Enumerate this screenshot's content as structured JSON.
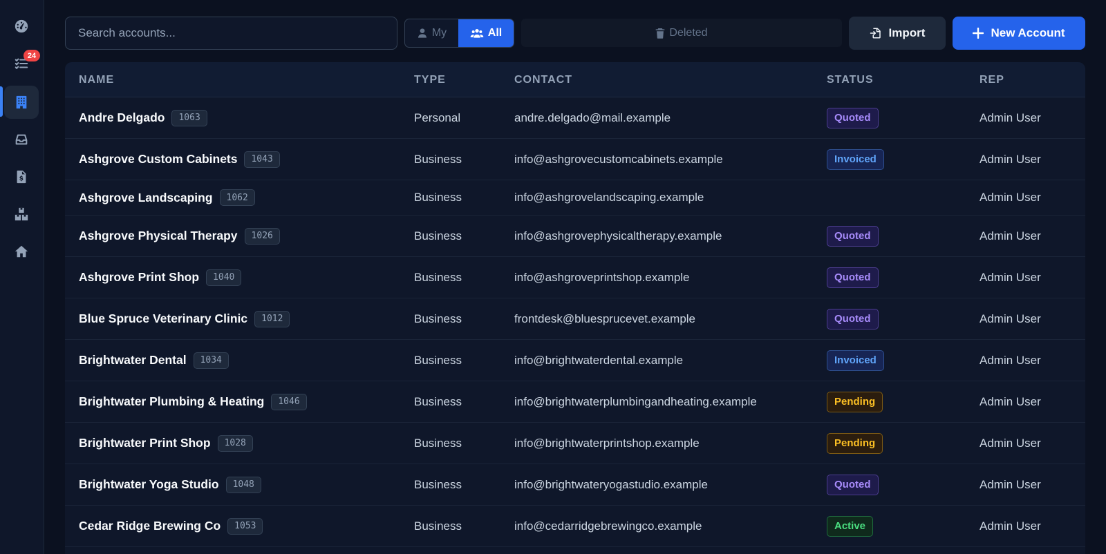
{
  "sidebar": {
    "items": [
      {
        "icon": "dashboard-icon"
      },
      {
        "icon": "tasks-icon",
        "badge": "24"
      },
      {
        "icon": "building-icon",
        "active": true
      },
      {
        "icon": "inbox-icon"
      },
      {
        "icon": "invoice-icon"
      },
      {
        "icon": "boxes-icon"
      },
      {
        "icon": "home-icon"
      }
    ]
  },
  "toolbar": {
    "search_placeholder": "Search accounts...",
    "filter_my": "My",
    "filter_all": "All",
    "deleted_label": "Deleted",
    "import_label": "Import",
    "new_account_label": "New Account"
  },
  "table": {
    "columns": {
      "name": "NAME",
      "type": "TYPE",
      "contact": "CONTACT",
      "status": "STATUS",
      "rep": "REP"
    },
    "rows": [
      {
        "name": "Andre Delgado",
        "id": "1063",
        "type": "Personal",
        "contact": "andre.delgado@mail.example",
        "status": "Quoted",
        "rep": "Admin User"
      },
      {
        "name": "Ashgrove Custom Cabinets",
        "id": "1043",
        "type": "Business",
        "contact": "info@ashgrovecustomcabinets.example",
        "status": "Invoiced",
        "rep": "Admin User"
      },
      {
        "name": "Ashgrove Landscaping",
        "id": "1062",
        "type": "Business",
        "contact": "info@ashgrovelandscaping.example",
        "status": "",
        "rep": "Admin User"
      },
      {
        "name": "Ashgrove Physical Therapy",
        "id": "1026",
        "type": "Business",
        "contact": "info@ashgrovephysicaltherapy.example",
        "status": "Quoted",
        "rep": "Admin User"
      },
      {
        "name": "Ashgrove Print Shop",
        "id": "1040",
        "type": "Business",
        "contact": "info@ashgroveprintshop.example",
        "status": "Quoted",
        "rep": "Admin User"
      },
      {
        "name": "Blue Spruce Veterinary Clinic",
        "id": "1012",
        "type": "Business",
        "contact": "frontdesk@bluesprucevet.example",
        "status": "Quoted",
        "rep": "Admin User"
      },
      {
        "name": "Brightwater Dental",
        "id": "1034",
        "type": "Business",
        "contact": "info@brightwaterdental.example",
        "status": "Invoiced",
        "rep": "Admin User"
      },
      {
        "name": "Brightwater Plumbing & Heating",
        "id": "1046",
        "type": "Business",
        "contact": "info@brightwaterplumbingandheating.example",
        "status": "Pending",
        "rep": "Admin User"
      },
      {
        "name": "Brightwater Print Shop",
        "id": "1028",
        "type": "Business",
        "contact": "info@brightwaterprintshop.example",
        "status": "Pending",
        "rep": "Admin User"
      },
      {
        "name": "Brightwater Yoga Studio",
        "id": "1048",
        "type": "Business",
        "contact": "info@brightwateryogastudio.example",
        "status": "Quoted",
        "rep": "Admin User"
      },
      {
        "name": "Cedar Ridge Brewing Co",
        "id": "1053",
        "type": "Business",
        "contact": "info@cedarridgebrewingco.example",
        "status": "Active",
        "rep": "Admin User"
      }
    ]
  },
  "colors": {
    "accent": "#2563eb",
    "background": "#0b1120",
    "quoted": "#a78bfa",
    "invoiced": "#60a5fa",
    "pending": "#fbbf24",
    "active": "#4ade80",
    "badge_red": "#ef4444"
  }
}
